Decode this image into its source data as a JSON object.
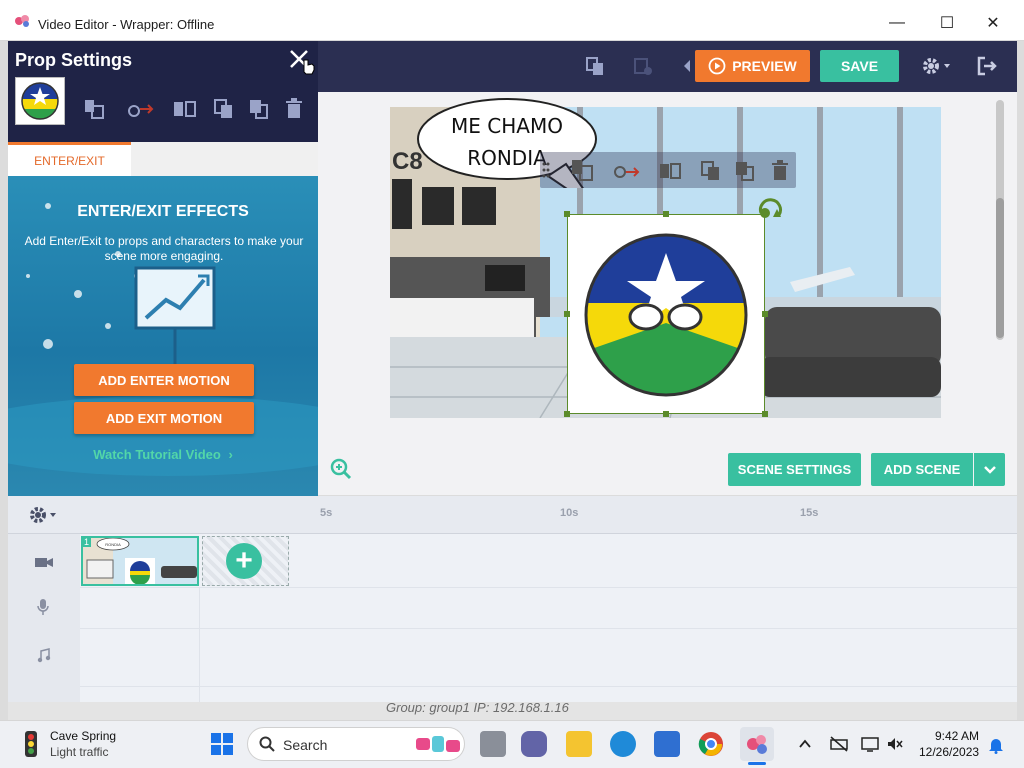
{
  "window": {
    "title": "Video Editor - Wrapper: Offline",
    "minimize": "—",
    "maximize": "☐",
    "close": "✕"
  },
  "toolbar": {
    "preview_label": "PREVIEW",
    "save_label": "SAVE"
  },
  "panel": {
    "title": "Prop Settings",
    "tab_label": "ENTER/EXIT",
    "heading": "ENTER/EXIT EFFECTS",
    "description": "Add Enter/Exit to props and characters to make your scene more engaging.",
    "add_enter_label": "ADD ENTER MOTION",
    "add_exit_label": "ADD EXIT MOTION",
    "watch_label": "Watch Tutorial Video"
  },
  "scene": {
    "bubble_line1": "ME CHAMO",
    "bubble_line2": "RONDIA",
    "sign_text": "C8",
    "settings_label": "SCENE SETTINGS",
    "add_scene_label": "ADD SCENE"
  },
  "timeline": {
    "ticks": [
      "5s",
      "10s",
      "15s"
    ],
    "scene_number": "1",
    "mini_bubble_text": "RONDIA"
  },
  "status": {
    "text": "Group: group1   IP: 192.168.1.16"
  },
  "taskbar": {
    "weather_title": "Cave Spring",
    "weather_sub": "Light traffic",
    "search_label": "Search",
    "time": "9:42 AM",
    "date": "12/26/2023"
  },
  "colors": {
    "accent_orange": "#f1792e",
    "accent_teal": "#39c0a0",
    "navy": "#1f2346"
  }
}
